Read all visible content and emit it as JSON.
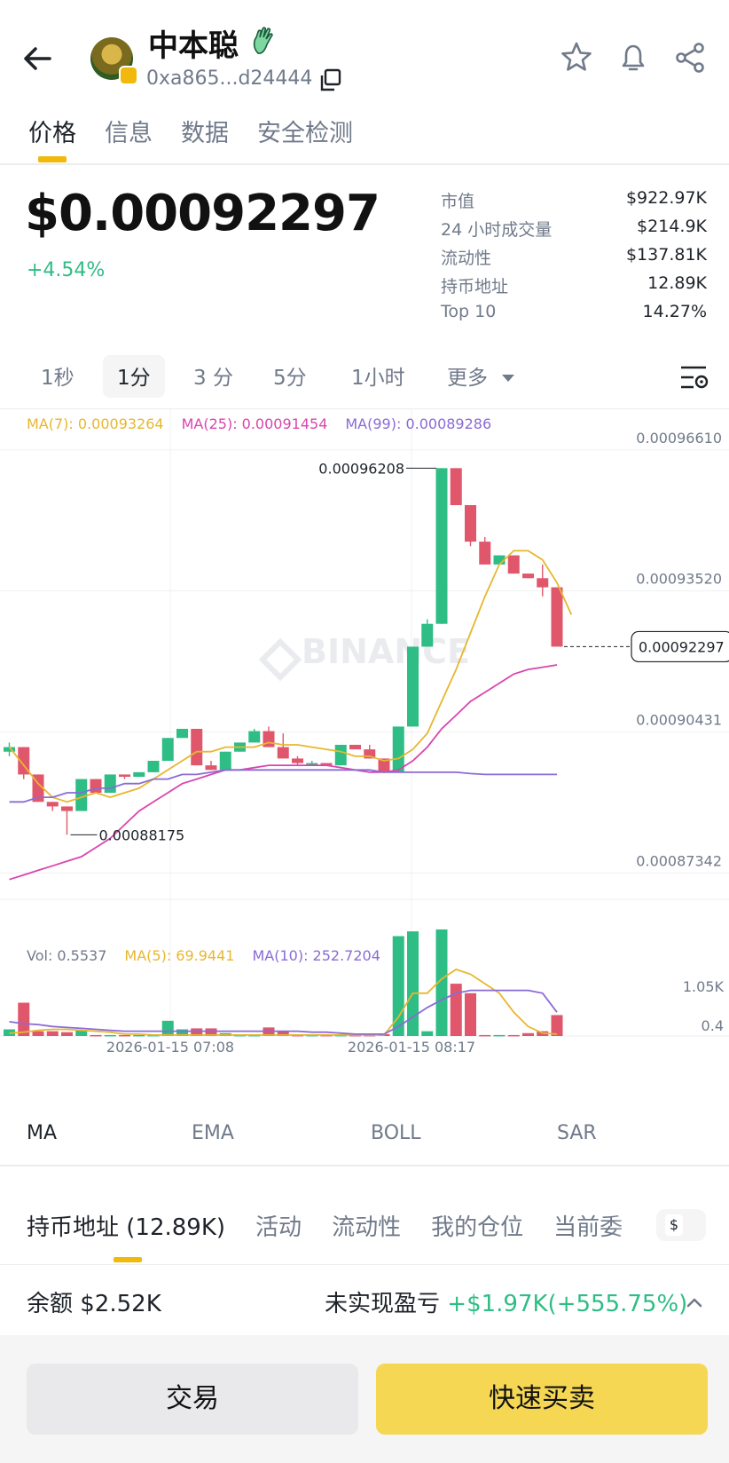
{
  "header": {
    "token_name": "中本聪",
    "address": "0xa865...d24444"
  },
  "tabs": [
    "价格",
    "信息",
    "数据",
    "安全检测"
  ],
  "price": {
    "value": "$0.00092297",
    "change": "+4.54%"
  },
  "stats": [
    {
      "label": "市值",
      "value": "$922.97K"
    },
    {
      "label": "24 小时成交量",
      "value": "$214.9K"
    },
    {
      "label": "流动性",
      "value": "$137.81K"
    },
    {
      "label": "持币地址",
      "value": "12.89K"
    },
    {
      "label": "Top 10",
      "value": "14.27%"
    }
  ],
  "intervals": [
    "1秒",
    "1分",
    "3 分",
    "5分",
    "1小时",
    "更多"
  ],
  "active_interval": "1分",
  "chart_legend": {
    "ma7": "MA(7): 0.00093264",
    "ma25": "MA(25): 0.00091454",
    "ma99": "MA(99): 0.00089286",
    "vol": "Vol: 0.5537",
    "vma5": "MA(5): 69.9441",
    "vma10": "MA(10): 252.7204"
  },
  "watermark": "BINANCE",
  "colors": {
    "up": "#2ebd85",
    "down": "#e0576b",
    "accent": "#f0b90b",
    "ma7": "#e7b72f",
    "ma25": "#d946ae",
    "ma99": "#8a6bd6"
  },
  "chart_data": {
    "type": "candlestick",
    "price_axis_labels": [
      "0.00096610",
      "0.00093520",
      "0.00090431",
      "0.00087342"
    ],
    "price_axis_values": [
      0.0009661,
      0.0009352,
      0.00090431,
      0.00087342
    ],
    "high_label": "0.00096208",
    "low_label": "0.00088175",
    "last_price_label": "0.00092297",
    "volume_axis_labels": [
      "1.05K",
      "0.4"
    ],
    "time_labels": [
      "2026-01-15 07:08",
      "2026-01-15 08:17"
    ],
    "candles": [
      {
        "o": 0.0009,
        "h": 0.000902,
        "l": 0.000899,
        "c": 0.000901
      },
      {
        "o": 0.000901,
        "h": 0.000901,
        "l": 0.000894,
        "c": 0.000895
      },
      {
        "o": 0.000895,
        "h": 0.000895,
        "l": 0.000889,
        "c": 0.000889
      },
      {
        "o": 0.000889,
        "h": 0.000889,
        "l": 0.000887,
        "c": 0.000888
      },
      {
        "o": 0.000888,
        "h": 0.000888,
        "l": 0.0008818,
        "c": 0.000887
      },
      {
        "o": 0.000887,
        "h": 0.000894,
        "l": 0.000887,
        "c": 0.000894
      },
      {
        "o": 0.000894,
        "h": 0.000894,
        "l": 0.000891,
        "c": 0.000891
      },
      {
        "o": 0.000891,
        "h": 0.000895,
        "l": 0.000891,
        "c": 0.000895
      },
      {
        "o": 0.000895,
        "h": 0.000895,
        "l": 0.000894,
        "c": 0.0008945
      },
      {
        "o": 0.0008945,
        "h": 0.0008955,
        "l": 0.0008945,
        "c": 0.0008955
      },
      {
        "o": 0.0008955,
        "h": 0.000898,
        "l": 0.0008955,
        "c": 0.000898
      },
      {
        "o": 0.000898,
        "h": 0.000903,
        "l": 0.000898,
        "c": 0.000903
      },
      {
        "o": 0.000903,
        "h": 0.000905,
        "l": 0.000903,
        "c": 0.000905
      },
      {
        "o": 0.000905,
        "h": 0.000905,
        "l": 0.000897,
        "c": 0.000897
      },
      {
        "o": 0.000897,
        "h": 0.000898,
        "l": 0.000896,
        "c": 0.000896
      },
      {
        "o": 0.000896,
        "h": 0.0009,
        "l": 0.000896,
        "c": 0.0009
      },
      {
        "o": 0.0009,
        "h": 0.000902,
        "l": 0.0009,
        "c": 0.000902
      },
      {
        "o": 0.000902,
        "h": 0.000905,
        "l": 0.000902,
        "c": 0.0009045
      },
      {
        "o": 0.0009045,
        "h": 0.0009055,
        "l": 0.000901,
        "c": 0.000901
      },
      {
        "o": 0.000901,
        "h": 0.000904,
        "l": 0.0008985,
        "c": 0.0008985
      },
      {
        "o": 0.0008985,
        "h": 0.000899,
        "l": 0.000897,
        "c": 0.0008975
      },
      {
        "o": 0.0008975,
        "h": 0.000898,
        "l": 0.000897,
        "c": 0.0008975
      },
      {
        "o": 0.0008975,
        "h": 0.0008975,
        "l": 0.000897,
        "c": 0.000897
      },
      {
        "o": 0.000897,
        "h": 0.0009015,
        "l": 0.000897,
        "c": 0.0009015
      },
      {
        "o": 0.0009015,
        "h": 0.0009015,
        "l": 0.0009005,
        "c": 0.0009005
      },
      {
        "o": 0.0009005,
        "h": 0.0009015,
        "l": 0.0008985,
        "c": 0.0008985
      },
      {
        "o": 0.0008985,
        "h": 0.0008985,
        "l": 0.0008955,
        "c": 0.0008955
      },
      {
        "o": 0.0008955,
        "h": 0.0009055,
        "l": 0.0008955,
        "c": 0.0009055
      },
      {
        "o": 0.0009055,
        "h": 0.000923,
        "l": 0.0009055,
        "c": 0.000923
      },
      {
        "o": 0.000923,
        "h": 0.000929,
        "l": 0.000923,
        "c": 0.000928
      },
      {
        "o": 0.000928,
        "h": 0.0009621,
        "l": 0.000928,
        "c": 0.0009621
      },
      {
        "o": 0.0009621,
        "h": 0.0009621,
        "l": 0.000954,
        "c": 0.000954
      },
      {
        "o": 0.000954,
        "h": 0.000954,
        "l": 0.000945,
        "c": 0.000946
      },
      {
        "o": 0.000946,
        "h": 0.000947,
        "l": 0.000941,
        "c": 0.000941
      },
      {
        "o": 0.000941,
        "h": 0.000943,
        "l": 0.000941,
        "c": 0.000943
      },
      {
        "o": 0.000943,
        "h": 0.000943,
        "l": 0.000939,
        "c": 0.000939
      },
      {
        "o": 0.000939,
        "h": 0.000939,
        "l": 0.000938,
        "c": 0.000938
      },
      {
        "o": 0.000938,
        "h": 0.000941,
        "l": 0.000934,
        "c": 0.000936
      },
      {
        "o": 0.000936,
        "h": 0.000936,
        "l": 0.000923,
        "c": 0.000923
      }
    ],
    "ma7": [
      0.000901,
      0.000897,
      0.000893,
      0.00089,
      0.000889,
      0.00089,
      0.000891,
      0.00089,
      0.000891,
      0.000892,
      0.000894,
      0.000896,
      0.000898,
      0.0009,
      0.0009,
      0.000901,
      0.000901,
      0.000901,
      0.000902,
      0.0009015,
      0.0009015,
      0.000901,
      0.0009005,
      0.0009,
      0.000899,
      0.000899,
      0.000898,
      0.0008985,
      0.0009005,
      0.000904,
      0.000911,
      0.000918,
      0.000926,
      0.000934,
      0.000941,
      0.000944,
      0.000944,
      0.000942,
      0.000937,
      0.00093
    ],
    "ma25": [
      0.000872,
      0.000873,
      0.000874,
      0.000875,
      0.000876,
      0.000877,
      0.000879,
      0.000881,
      0.000884,
      0.000887,
      0.000889,
      0.000891,
      0.000893,
      0.000894,
      0.000895,
      0.000896,
      0.000896,
      0.0008965,
      0.000897,
      0.000897,
      0.000897,
      0.000897,
      0.000897,
      0.0008965,
      0.000896,
      0.0008955,
      0.0008955,
      0.000896,
      0.000898,
      0.000901,
      0.000905,
      0.000908,
      0.000911,
      0.000913,
      0.000915,
      0.000917,
      0.000918,
      0.0009185,
      0.000919
    ],
    "ma99": [
      0.000889,
      0.000889,
      0.00089,
      0.00089,
      0.000891,
      0.000891,
      0.000892,
      0.000892,
      0.000893,
      0.000893,
      0.000894,
      0.000894,
      0.000895,
      0.000895,
      0.0008955,
      0.000896,
      0.000896,
      0.000896,
      0.000896,
      0.000896,
      0.000896,
      0.000896,
      0.000896,
      0.000896,
      0.000896,
      0.000896,
      0.0008955,
      0.0008955,
      0.0008955,
      0.0008955,
      0.0008955,
      0.0008955,
      0.0008952,
      0.000895,
      0.000895,
      0.000895,
      0.000895,
      0.000895,
      0.000895
    ],
    "volumes": [
      0.07,
      0.35,
      0.05,
      0.05,
      0.04,
      0.06,
      0.01,
      0.01,
      0.01,
      0.01,
      0.01,
      0.16,
      0.07,
      0.08,
      0.08,
      0.03,
      0.01,
      0.01,
      0.09,
      0.05,
      0.01,
      0.01,
      0.01,
      0.01,
      0.01,
      0.01,
      0.02,
      1.05,
      1.1,
      0.05,
      1.12,
      0.55,
      0.45,
      0.01,
      0.01,
      0.01,
      0.03,
      0.05,
      0.22
    ],
    "vol_ma5": [
      0.03,
      0.04,
      0.06,
      0.07,
      0.07,
      0.06,
      0.05,
      0.04,
      0.02,
      0.02,
      0.01,
      0.01,
      0.01,
      0.01,
      0.01,
      0.01,
      0.01,
      0.01,
      0.01,
      0.01,
      0.01,
      0.01,
      0.01,
      0.01,
      0.01,
      0.01,
      0.01,
      0.2,
      0.45,
      0.45,
      0.6,
      0.7,
      0.65,
      0.55,
      0.45,
      0.25,
      0.1,
      0.03,
      0.02
    ],
    "vol_ma10": [
      0.15,
      0.13,
      0.12,
      0.1,
      0.09,
      0.08,
      0.07,
      0.06,
      0.05,
      0.05,
      0.05,
      0.05,
      0.05,
      0.05,
      0.05,
      0.05,
      0.05,
      0.05,
      0.05,
      0.05,
      0.05,
      0.04,
      0.04,
      0.03,
      0.02,
      0.02,
      0.02,
      0.1,
      0.2,
      0.3,
      0.38,
      0.45,
      0.48,
      0.48,
      0.48,
      0.48,
      0.48,
      0.45,
      0.25
    ]
  },
  "indicators": [
    "MA",
    "EMA",
    "BOLL",
    "SAR"
  ],
  "active_indicator": "MA",
  "holder_tabs": [
    "持币地址 (12.89K)",
    "活动",
    "流动性",
    "我的仓位",
    "当前委"
  ],
  "currency_symbol": "$",
  "balance": {
    "label": "余额 $2.52K",
    "pnl_label": "未实现盈亏",
    "pnl_value": "+$1.97K(+555.75%)"
  },
  "buttons": {
    "trade": "交易",
    "quick": "快速买卖"
  }
}
